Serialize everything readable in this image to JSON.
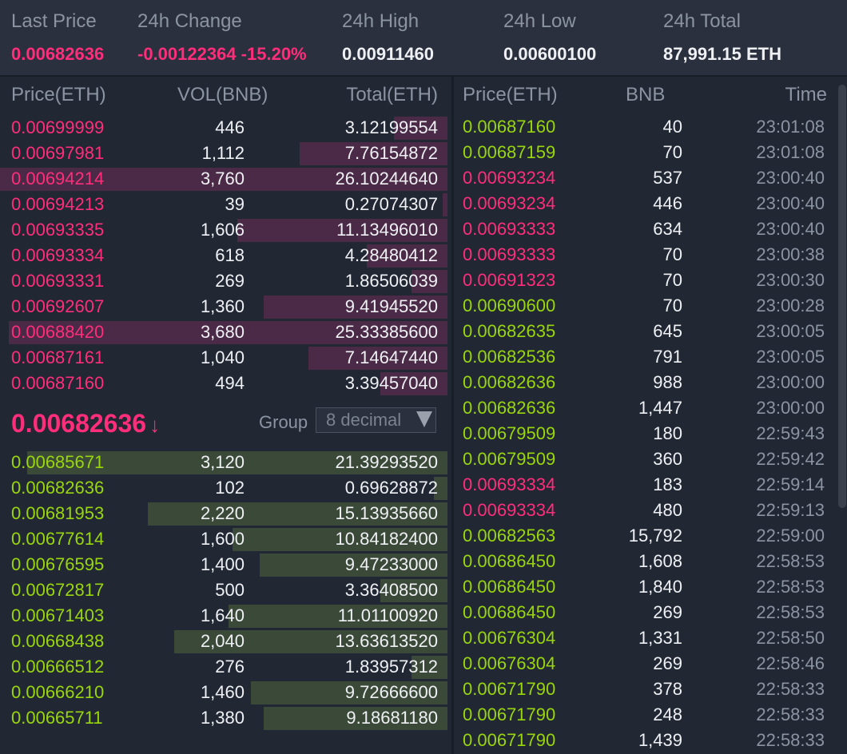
{
  "header": {
    "last_price": {
      "label": "Last Price",
      "value": "0.00682636"
    },
    "change": {
      "label": "24h Change",
      "value": "-0.00122364 -15.20%"
    },
    "high": {
      "label": "24h High",
      "value": "0.00911460"
    },
    "low": {
      "label": "24h Low",
      "value": "0.00600100"
    },
    "total": {
      "label": "24h Total",
      "value": "87,991.15 ETH"
    }
  },
  "orderbook": {
    "headers": {
      "price": "Price(ETH)",
      "vol": "VOL(BNB)",
      "total": "Total(ETH)"
    },
    "asks": [
      {
        "price": "0.00699999",
        "vol": "446",
        "total": "3.12199554",
        "depth": 0.12
      },
      {
        "price": "0.00697981",
        "vol": "1,112",
        "total": "7.76154872",
        "depth": 0.33
      },
      {
        "price": "0.00694214",
        "vol": "3,760",
        "total": "26.10244640",
        "depth": 1.0
      },
      {
        "price": "0.00694213",
        "vol": "39",
        "total": "0.27074307",
        "depth": 0.01
      },
      {
        "price": "0.00693335",
        "vol": "1,606",
        "total": "11.13496010",
        "depth": 0.47
      },
      {
        "price": "0.00693334",
        "vol": "618",
        "total": "4.28480412",
        "depth": 0.18
      },
      {
        "price": "0.00693331",
        "vol": "269",
        "total": "1.86506039",
        "depth": 0.08
      },
      {
        "price": "0.00692607",
        "vol": "1,360",
        "total": "9.41945520",
        "depth": 0.41
      },
      {
        "price": "0.00688420",
        "vol": "3,680",
        "total": "25.33385600",
        "depth": 0.98
      },
      {
        "price": "0.00687161",
        "vol": "1,040",
        "total": "7.14647440",
        "depth": 0.31
      },
      {
        "price": "0.00687160",
        "vol": "494",
        "total": "3.39457040",
        "depth": 0.15
      }
    ],
    "last_price": "0.00682636",
    "last_arrow": "↓",
    "group": {
      "label": "Group",
      "value": "8 decimal"
    },
    "bids": [
      {
        "price": "0.00685671",
        "vol": "3,120",
        "total": "21.39293520",
        "depth": 0.94
      },
      {
        "price": "0.00682636",
        "vol": "102",
        "total": "0.69628872",
        "depth": 0.03
      },
      {
        "price": "0.00681953",
        "vol": "2,220",
        "total": "15.13935660",
        "depth": 0.67
      },
      {
        "price": "0.00677614",
        "vol": "1,600",
        "total": "10.84182400",
        "depth": 0.48
      },
      {
        "price": "0.00676595",
        "vol": "1,400",
        "total": "9.47233000",
        "depth": 0.42
      },
      {
        "price": "0.00672817",
        "vol": "500",
        "total": "3.36408500",
        "depth": 0.15
      },
      {
        "price": "0.00671403",
        "vol": "1,640",
        "total": "11.01100920",
        "depth": 0.49
      },
      {
        "price": "0.00668438",
        "vol": "2,040",
        "total": "13.63613520",
        "depth": 0.61
      },
      {
        "price": "0.00666512",
        "vol": "276",
        "total": "1.83957312",
        "depth": 0.08
      },
      {
        "price": "0.00666210",
        "vol": "1,460",
        "total": "9.72666600",
        "depth": 0.44
      },
      {
        "price": "0.00665711",
        "vol": "1,380",
        "total": "9.18681180",
        "depth": 0.41
      }
    ]
  },
  "trades": {
    "headers": {
      "price": "Price(ETH)",
      "amount": "BNB",
      "time": "Time"
    },
    "rows": [
      {
        "price": "0.00687160",
        "amount": "40",
        "time": "23:01:08",
        "side": "buy"
      },
      {
        "price": "0.00687159",
        "amount": "70",
        "time": "23:01:08",
        "side": "buy"
      },
      {
        "price": "0.00693234",
        "amount": "537",
        "time": "23:00:40",
        "side": "sell"
      },
      {
        "price": "0.00693234",
        "amount": "446",
        "time": "23:00:40",
        "side": "sell"
      },
      {
        "price": "0.00693333",
        "amount": "634",
        "time": "23:00:40",
        "side": "sell"
      },
      {
        "price": "0.00693333",
        "amount": "70",
        "time": "23:00:38",
        "side": "sell"
      },
      {
        "price": "0.00691323",
        "amount": "70",
        "time": "23:00:30",
        "side": "sell"
      },
      {
        "price": "0.00690600",
        "amount": "70",
        "time": "23:00:28",
        "side": "buy"
      },
      {
        "price": "0.00682635",
        "amount": "645",
        "time": "23:00:05",
        "side": "buy"
      },
      {
        "price": "0.00682536",
        "amount": "791",
        "time": "23:00:05",
        "side": "buy"
      },
      {
        "price": "0.00682636",
        "amount": "988",
        "time": "23:00:00",
        "side": "buy"
      },
      {
        "price": "0.00682636",
        "amount": "1,447",
        "time": "23:00:00",
        "side": "buy"
      },
      {
        "price": "0.00679509",
        "amount": "180",
        "time": "22:59:43",
        "side": "buy"
      },
      {
        "price": "0.00679509",
        "amount": "360",
        "time": "22:59:42",
        "side": "buy"
      },
      {
        "price": "0.00693334",
        "amount": "183",
        "time": "22:59:14",
        "side": "sell"
      },
      {
        "price": "0.00693334",
        "amount": "480",
        "time": "22:59:13",
        "side": "sell"
      },
      {
        "price": "0.00682563",
        "amount": "15,792",
        "time": "22:59:00",
        "side": "buy"
      },
      {
        "price": "0.00686450",
        "amount": "1,608",
        "time": "22:58:53",
        "side": "buy"
      },
      {
        "price": "0.00686450",
        "amount": "1,840",
        "time": "22:58:53",
        "side": "buy"
      },
      {
        "price": "0.00686450",
        "amount": "269",
        "time": "22:58:53",
        "side": "buy"
      },
      {
        "price": "0.00676304",
        "amount": "1,331",
        "time": "22:58:50",
        "side": "buy"
      },
      {
        "price": "0.00676304",
        "amount": "269",
        "time": "22:58:46",
        "side": "buy"
      },
      {
        "price": "0.00671790",
        "amount": "378",
        "time": "22:58:33",
        "side": "buy"
      },
      {
        "price": "0.00671790",
        "amount": "248",
        "time": "22:58:33",
        "side": "buy"
      },
      {
        "price": "0.00671790",
        "amount": "1,439",
        "time": "22:58:33",
        "side": "buy"
      }
    ]
  },
  "colors": {
    "sell": "#ff2d7a",
    "buy": "#9ad60c",
    "ask_depth": "#4a2a46",
    "bid_depth": "#3b4a38",
    "background": "#212733"
  }
}
